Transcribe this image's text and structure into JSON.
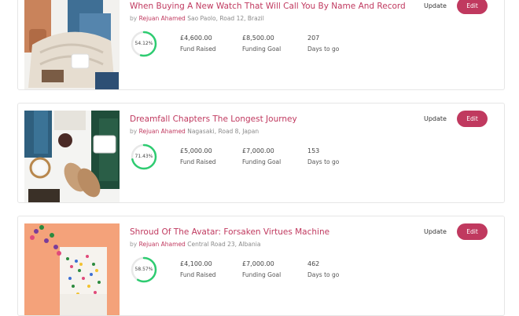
{
  "colors": {
    "accent": "#c0395f",
    "progress": "#2ecc71",
    "track": "#e8e8e8"
  },
  "campaigns": [
    {
      "title": "When Buying A New Watch That Will Call You By Name And Record",
      "by": "by",
      "author": "Rejuan Ahamed",
      "location": "Sao Paolo, Road 12, Brazil",
      "percent": "54.12%",
      "progress": 0.5412,
      "fund_raised": "£4,600.00",
      "fund_raised_label": "Fund Raised",
      "goal": "£8,500.00",
      "goal_label": "Funding Goal",
      "days": "207",
      "days_label": "Days to go",
      "update_label": "Update",
      "edit_label": "Edit",
      "image": "fashion-flatlay-boots-sweater"
    },
    {
      "title": "Dreamfall Chapters The Longest Journey",
      "by": "by",
      "author": "Rejuan Ahamed",
      "location": "Nagasaki, Road 8, Japan",
      "percent": "71.43%",
      "progress": 0.7143,
      "fund_raised": "£5,000.00",
      "fund_raised_label": "Fund Raised",
      "goal": "£7,000.00",
      "goal_label": "Funding Goal",
      "days": "153",
      "days_label": "Days to go",
      "update_label": "Update",
      "edit_label": "Edit",
      "image": "fashion-flatlay-loafers-mug"
    },
    {
      "title": "Shroud Of The Avatar: Forsaken Virtues Machine",
      "by": "by",
      "author": "Rejuan Ahamed",
      "location": "Central Road 23, Albania",
      "percent": "58.57%",
      "progress": 0.5857,
      "fund_raised": "£4,100.00",
      "fund_raised_label": "Fund Raised",
      "goal": "£7,000.00",
      "goal_label": "Funding Goal",
      "days": "462",
      "days_label": "Days to go",
      "update_label": "Update",
      "edit_label": "Edit",
      "image": "confetti-on-peach"
    }
  ]
}
